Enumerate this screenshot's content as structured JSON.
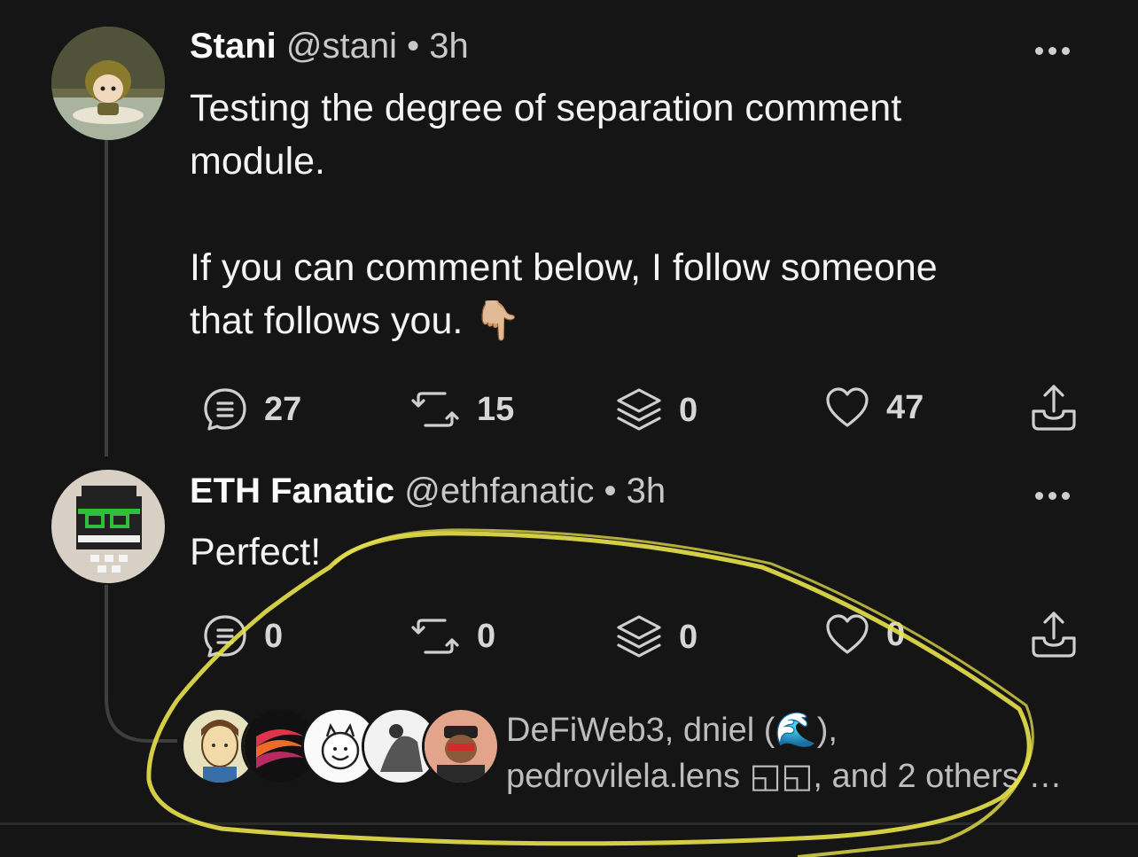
{
  "post": {
    "author_name": "Stani",
    "author_handle": "@stani",
    "time": "3h",
    "text_line1": "Testing the degree of separation comment",
    "text_line2": "module.",
    "text_line3": "If you can comment below, I follow someone",
    "text_line4": "that follows you. 👇🏼",
    "stats": {
      "comments": "27",
      "mirrors": "15",
      "collects": "0",
      "likes": "47"
    }
  },
  "reply": {
    "author_name": "ETH Fanatic",
    "author_handle": "@ethfanatic",
    "time": "3h",
    "text": "Perfect!",
    "stats": {
      "comments": "0",
      "mirrors": "0",
      "collects": "0",
      "likes": "0"
    }
  },
  "commenters": {
    "line1": "DeFiWeb3, dniel (🌊),",
    "line2": "pedrovilela.lens ◱◱, and 2 others …"
  },
  "colors": {
    "background": "#151515",
    "annotation": "#e8e24a",
    "text": "#f4f4f4",
    "muted": "#bdbdbd"
  }
}
